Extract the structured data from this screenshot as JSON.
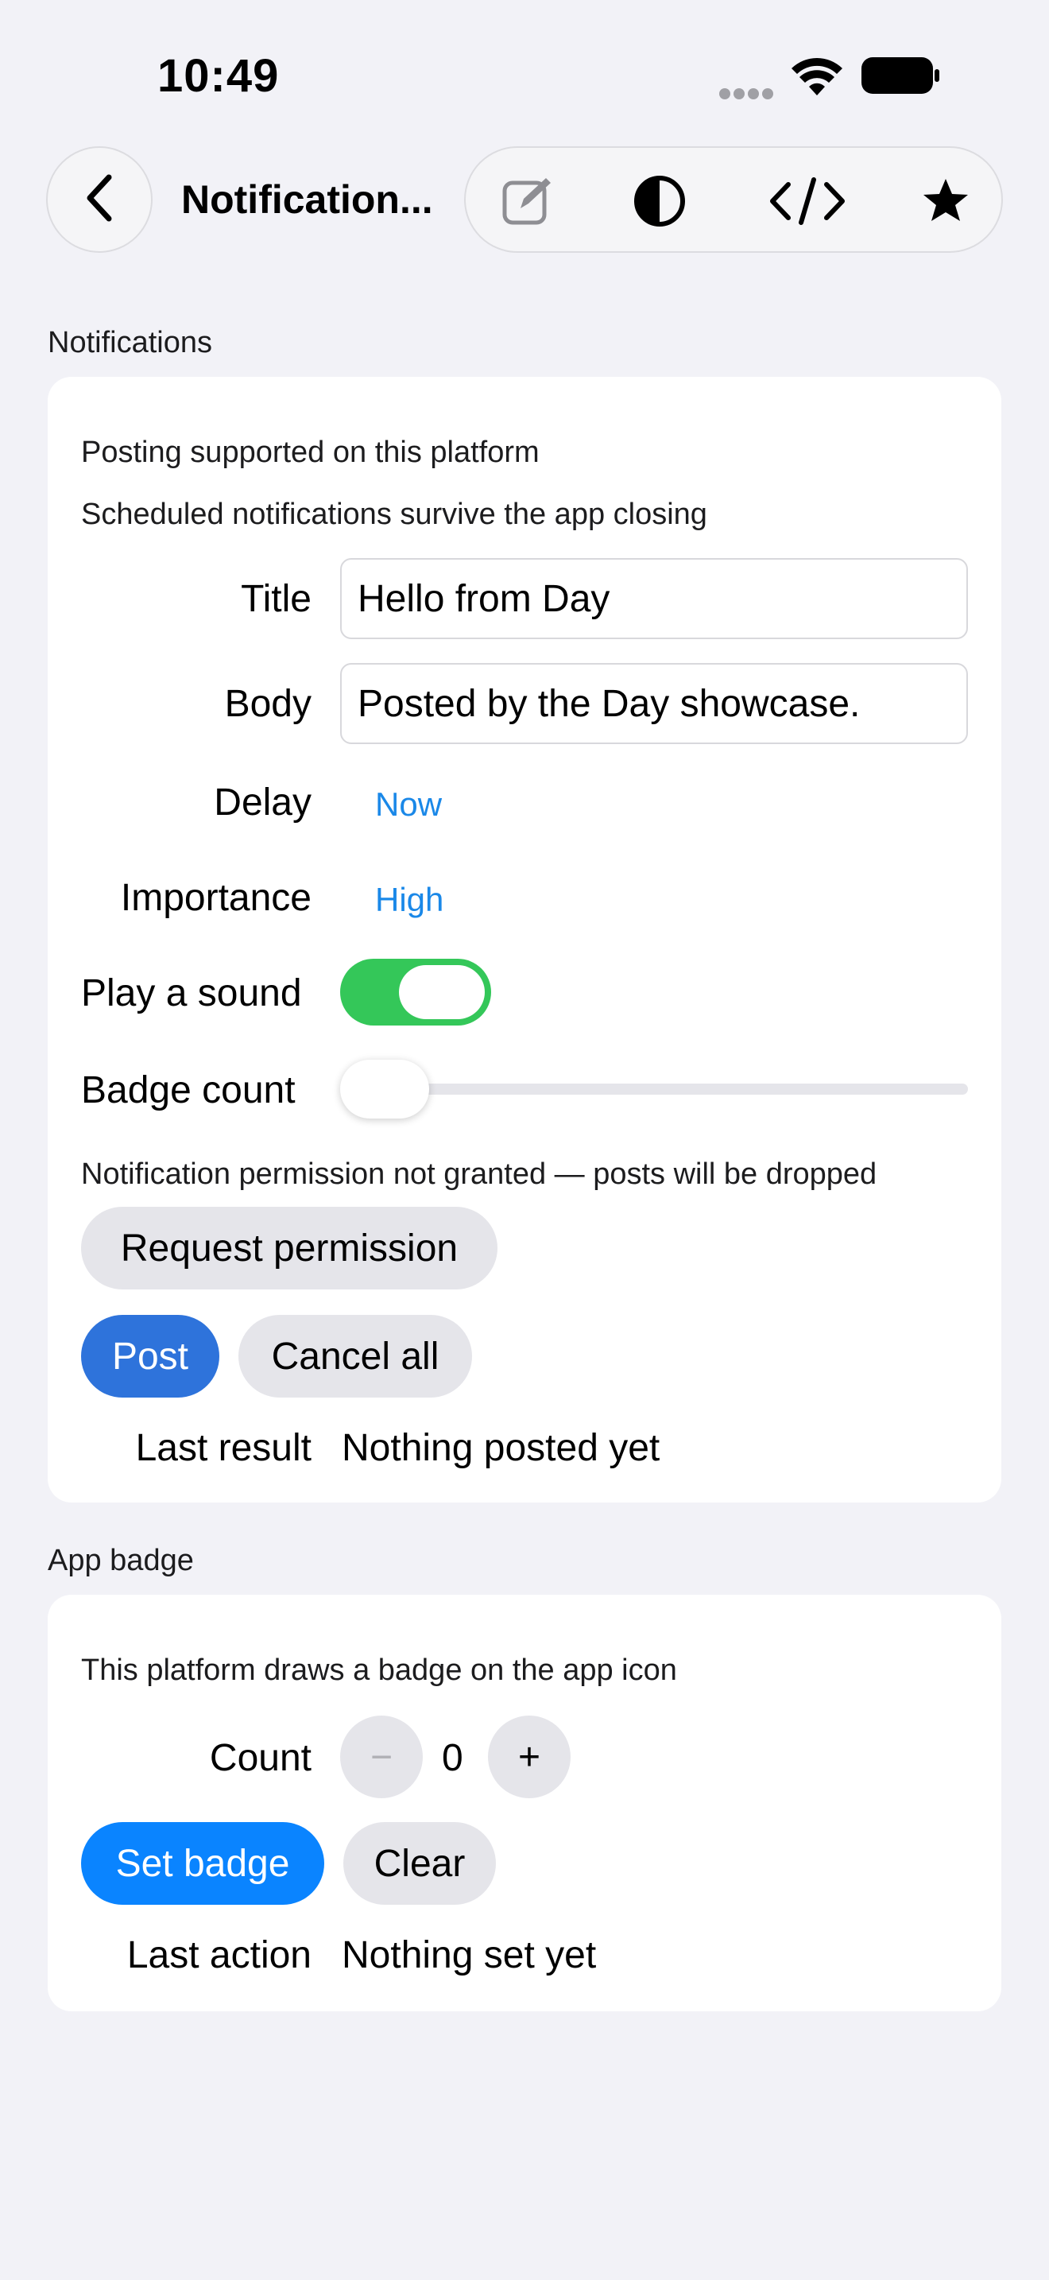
{
  "status_bar": {
    "time": "10:49"
  },
  "nav": {
    "title": "Notification...",
    "icons": [
      "back-chevron-icon",
      "compose-icon",
      "contrast-icon",
      "code-icon",
      "star-icon"
    ]
  },
  "notifications": {
    "section_title": "Notifications",
    "support_note": "Posting supported on this platform",
    "schedule_note": "Scheduled notifications survive the app closing",
    "title_label": "Title",
    "title_value": "Hello from Day",
    "body_label": "Body",
    "body_value": "Posted by the Day showcase.",
    "delay_label": "Delay",
    "delay_value": "Now",
    "importance_label": "Importance",
    "importance_value": "High",
    "sound_label": "Play a sound",
    "sound_on": true,
    "badge_label": "Badge count",
    "badge_level": 0,
    "permission_note": "Notification permission not granted — posts will be dropped",
    "request_button": "Request permission",
    "post_button": "Post",
    "cancel_button": "Cancel all",
    "last_result_label": "Last result",
    "last_result_value": "Nothing posted yet"
  },
  "app_badge": {
    "section_title": "App badge",
    "note": "This platform draws a badge on the app icon",
    "count_label": "Count",
    "decrement": "−",
    "count_value": "0",
    "increment": "+",
    "set_button": "Set badge",
    "clear_button": "Clear",
    "last_action_label": "Last action",
    "last_action_value": "Nothing set yet"
  },
  "colors": {
    "background": "#f2f2f7",
    "accent_link": "#1a88e8",
    "toggle_on": "#34c759",
    "post_blue": "#2e73db",
    "set_badge_blue": "#0a84ff"
  }
}
